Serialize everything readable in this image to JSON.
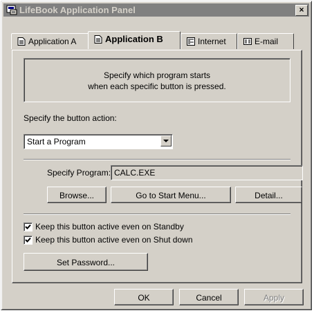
{
  "window": {
    "title": "LifeBook Application Panel",
    "close_label": "×"
  },
  "tabs": [
    {
      "label": "Application A",
      "icon": "document-icon",
      "active": false
    },
    {
      "label": "Application B",
      "icon": "document-icon",
      "active": true
    },
    {
      "label": "Internet",
      "icon": "internet-icon",
      "active": false
    },
    {
      "label": "E-mail",
      "icon": "email-icon",
      "active": false
    }
  ],
  "panel": {
    "info_line1": "Specify which program starts",
    "info_line2": "when each specific button is pressed.",
    "action_label": "Specify the button action:",
    "action_value": "Start a Program",
    "program_label": "Specify Program:",
    "program_value": "CALC.EXE",
    "browse_label": "Browse...",
    "start_menu_label": "Go to Start Menu...",
    "detail_label": "Detail...",
    "standby_label": "Keep this button active even on Standby",
    "standby_checked": true,
    "shutdown_label": "Keep this button active even on Shut down",
    "shutdown_checked": true,
    "password_label": "Set Password..."
  },
  "footer": {
    "ok_label": "OK",
    "cancel_label": "Cancel",
    "apply_label": "Apply",
    "apply_enabled": false
  }
}
